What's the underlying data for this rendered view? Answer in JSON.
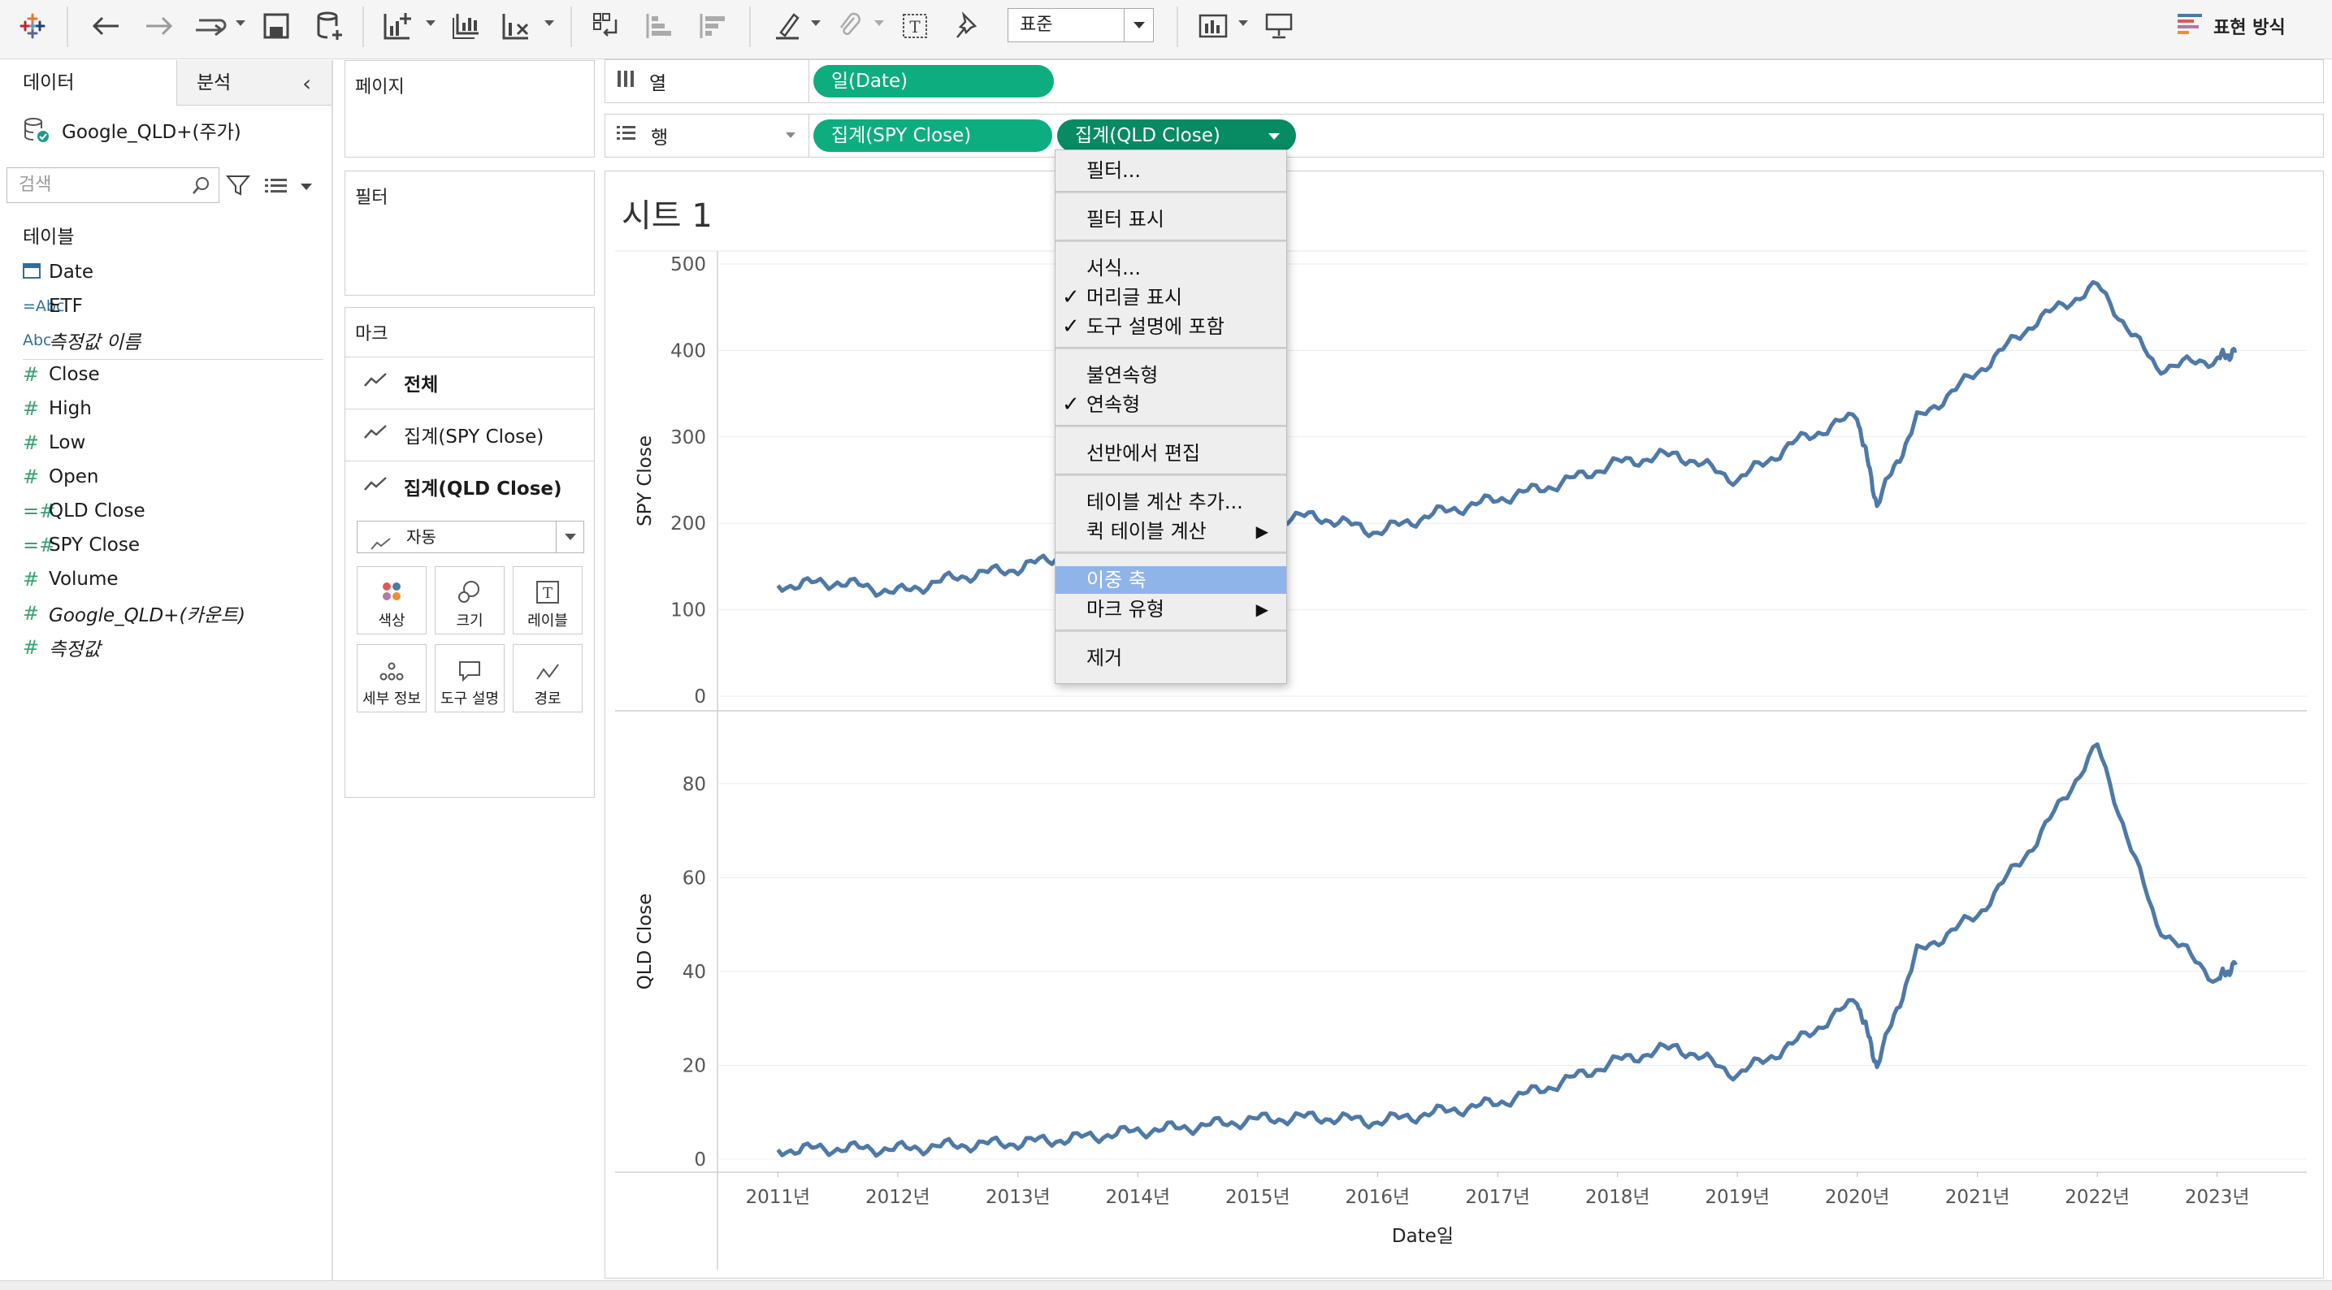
{
  "toolbar": {
    "font_select": "표준",
    "show_me_label": "표현 방식"
  },
  "left_pane": {
    "tab_data": "데이터",
    "tab_analytics": "분석",
    "data_source": "Google_QLD+(주가)",
    "search_placeholder": "검색",
    "tables_heading": "테이블",
    "fields": [
      {
        "icon": "date-icon",
        "name": "Date",
        "italic": false
      },
      {
        "icon": "string-icon",
        "icon_text": "=Abc",
        "name": "ETF",
        "italic": false
      },
      {
        "icon": "string-icon",
        "icon_text": "Abc",
        "name": "측정값 이름",
        "italic": true
      },
      {
        "icon": "number-icon",
        "icon_text": "#",
        "name": "Close",
        "italic": false
      },
      {
        "icon": "number-icon",
        "icon_text": "#",
        "name": "High",
        "italic": false
      },
      {
        "icon": "number-icon",
        "icon_text": "#",
        "name": "Low",
        "italic": false
      },
      {
        "icon": "number-icon",
        "icon_text": "#",
        "name": "Open",
        "italic": false
      },
      {
        "icon": "calc-number-icon",
        "icon_text": "=#",
        "name": "QLD Close",
        "italic": false
      },
      {
        "icon": "calc-number-icon",
        "icon_text": "=#",
        "name": "SPY Close",
        "italic": false
      },
      {
        "icon": "number-icon",
        "icon_text": "#",
        "name": "Volume",
        "italic": false
      },
      {
        "icon": "number-icon",
        "icon_text": "#",
        "name": "Google_QLD+(카운트)",
        "italic": true
      },
      {
        "icon": "number-icon",
        "icon_text": "#",
        "name": "측정값",
        "italic": true
      }
    ]
  },
  "cards": {
    "pages": "페이지",
    "filters": "필터",
    "marks": "마크",
    "marks_rows": [
      "전체",
      "집계(SPY Close)",
      "집계(QLD Close)"
    ],
    "mark_type": "자동",
    "mark_buttons": [
      "색상",
      "크기",
      "레이블",
      "세부 정보",
      "도구 설명",
      "경로"
    ]
  },
  "shelves": {
    "columns_label": "열",
    "rows_label": "행",
    "columns_pill": "일(Date)",
    "rows_pills": [
      "집계(SPY Close)",
      "집계(QLD Close)"
    ]
  },
  "sheet": {
    "title": "시트 1"
  },
  "context_menu": {
    "items": [
      {
        "label": "필터...",
        "checked": false,
        "submenu": false,
        "highlighted": false
      },
      {
        "label": "필터 표시",
        "checked": false,
        "submenu": false,
        "highlighted": false
      },
      {
        "label": "서식...",
        "checked": false,
        "submenu": false,
        "highlighted": false
      },
      {
        "label": "머리글 표시",
        "checked": true,
        "submenu": false,
        "highlighted": false
      },
      {
        "label": "도구 설명에 포함",
        "checked": true,
        "submenu": false,
        "highlighted": false
      },
      {
        "label": "불연속형",
        "checked": false,
        "submenu": false,
        "highlighted": false
      },
      {
        "label": "연속형",
        "checked": true,
        "submenu": false,
        "highlighted": false
      },
      {
        "label": "선반에서 편집",
        "checked": false,
        "submenu": false,
        "highlighted": false
      },
      {
        "label": "테이블 계산 추가...",
        "checked": false,
        "submenu": false,
        "highlighted": false
      },
      {
        "label": "퀵 테이블 계산",
        "checked": false,
        "submenu": true,
        "highlighted": false
      },
      {
        "label": "이중 축",
        "checked": false,
        "submenu": false,
        "highlighted": true
      },
      {
        "label": "마크 유형",
        "checked": false,
        "submenu": true,
        "highlighted": false
      },
      {
        "label": "제거",
        "checked": false,
        "submenu": false,
        "highlighted": false
      }
    ]
  },
  "chart_data": [
    {
      "type": "line",
      "ylabel": "SPY Close",
      "ylim": [
        0,
        500
      ],
      "yticks": [
        0,
        100,
        200,
        300,
        400,
        500
      ],
      "grid": true,
      "color": "#4e79a7",
      "x": [
        "2011-01",
        "2011-07",
        "2012-01",
        "2012-07",
        "2013-01",
        "2013-07",
        "2014-01",
        "2014-07",
        "2015-01",
        "2015-07",
        "2016-01",
        "2016-07",
        "2017-01",
        "2017-07",
        "2018-01",
        "2018-07",
        "2019-01",
        "2019-07",
        "2020-01",
        "2020-03",
        "2020-07",
        "2021-01",
        "2021-07",
        "2022-01",
        "2022-07",
        "2023-01",
        "2023-03"
      ],
      "values": [
        128,
        132,
        120,
        138,
        148,
        168,
        182,
        195,
        205,
        208,
        190,
        212,
        228,
        245,
        270,
        280,
        250,
        295,
        325,
        222,
        320,
        375,
        435,
        475,
        380,
        390,
        400
      ]
    },
    {
      "type": "line",
      "ylabel": "QLD Close",
      "xlabel": "Date일",
      "ylim": [
        0,
        90
      ],
      "yticks": [
        0,
        20,
        40,
        60,
        80
      ],
      "xticks": [
        "2011년",
        "2012년",
        "2013년",
        "2014년",
        "2015년",
        "2016년",
        "2017년",
        "2018년",
        "2019년",
        "2020년",
        "2021년",
        "2022년",
        "2023년"
      ],
      "grid": true,
      "color": "#4e79a7",
      "x": [
        "2011-01",
        "2011-07",
        "2012-01",
        "2012-07",
        "2013-01",
        "2013-07",
        "2014-01",
        "2014-07",
        "2015-01",
        "2015-07",
        "2016-01",
        "2016-07",
        "2017-01",
        "2017-07",
        "2018-01",
        "2018-07",
        "2019-01",
        "2019-07",
        "2020-01",
        "2020-03",
        "2020-07",
        "2021-01",
        "2021-07",
        "2022-01",
        "2022-07",
        "2023-01",
        "2023-03"
      ],
      "values": [
        2,
        2.3,
        2.2,
        3,
        3.5,
        4.5,
        6,
        7,
        8.5,
        9,
        8,
        10,
        12,
        16,
        21,
        24,
        18,
        25,
        34,
        20,
        44,
        52,
        68,
        88,
        50,
        38,
        42
      ]
    }
  ]
}
